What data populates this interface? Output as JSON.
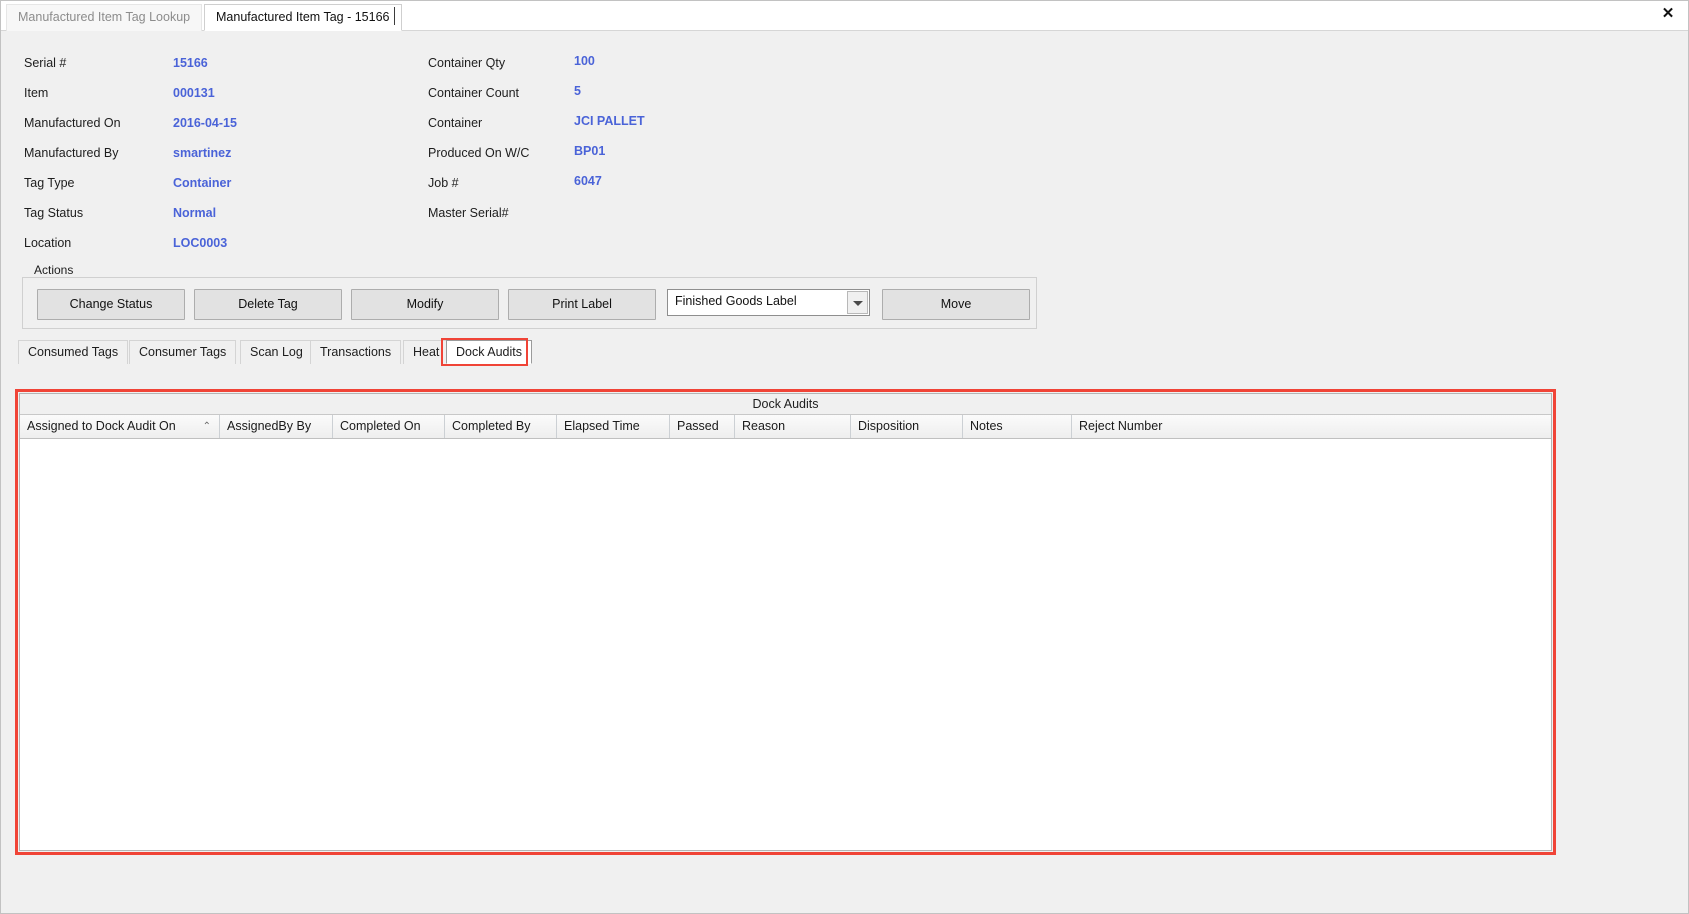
{
  "window": {
    "tabs": [
      {
        "label": "Manufactured Item Tag Lookup",
        "active": false
      },
      {
        "label": "Manufactured Item Tag - 15166",
        "active": true
      }
    ],
    "close_label": "✕"
  },
  "details": {
    "left": [
      {
        "label": "Serial #",
        "value": "15166"
      },
      {
        "label": "Item",
        "value": "000131"
      },
      {
        "label": "Manufactured On",
        "value": "2016-04-15"
      },
      {
        "label": "Manufactured By",
        "value": "smartinez"
      },
      {
        "label": "Tag Type",
        "value": "Container"
      },
      {
        "label": "Tag Status",
        "value": "Normal"
      },
      {
        "label": "Location",
        "value": "LOC0003"
      }
    ],
    "right": [
      {
        "label": "Container Qty",
        "value": "100"
      },
      {
        "label": "Container Count",
        "value": "5"
      },
      {
        "label": "Container",
        "value": "JCI PALLET"
      },
      {
        "label": "Produced On W/C",
        "value": "BP01"
      },
      {
        "label": "Job #",
        "value": "6047"
      },
      {
        "label": "Master Serial#",
        "value": ""
      }
    ]
  },
  "actions": {
    "title": "Actions",
    "buttons": [
      {
        "label": "Change Status"
      },
      {
        "label": "Delete Tag"
      },
      {
        "label": "Modify"
      },
      {
        "label": "Print Label"
      },
      {
        "label": "Move"
      }
    ],
    "label_select": {
      "value": "Finished Goods Label",
      "options": [
        "Finished Goods Label"
      ]
    }
  },
  "inner_tabs": [
    {
      "label": "Consumed Tags",
      "selected": false
    },
    {
      "label": "Consumer Tags",
      "selected": false
    },
    {
      "label": "Scan Log",
      "selected": false
    },
    {
      "label": "Transactions",
      "selected": false
    },
    {
      "label": "Heat",
      "selected": false
    },
    {
      "label": "Dock Audits",
      "selected": true
    }
  ],
  "grid": {
    "caption": "Dock Audits",
    "sort_indicator": "⌃",
    "columns": [
      "Assigned to Dock Audit On",
      "AssignedBy By",
      "Completed On",
      "Completed By",
      "Elapsed Time",
      "Passed",
      "Reason",
      "Disposition",
      "Notes",
      "Reject Number"
    ],
    "rows": []
  },
  "colors": {
    "value_blue": "#4a63d8",
    "highlight_red": "#f04437",
    "app_background": "#f0f0f0"
  }
}
